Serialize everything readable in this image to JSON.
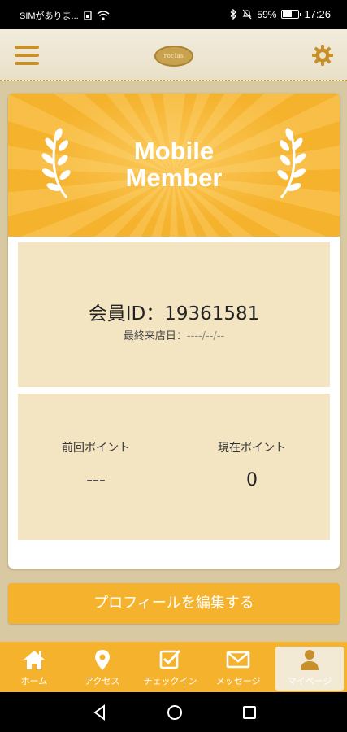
{
  "status_bar": {
    "carrier": "SIMがありま...",
    "battery": "59%",
    "time": "17:26"
  },
  "header": {
    "logo_text": "roclas"
  },
  "banner": {
    "title_line1": "Mobile",
    "title_line2": "Member"
  },
  "member": {
    "id_text": "会員ID：19361581",
    "last_visit_label": "最終来店日：",
    "last_visit_value": "----/--/--"
  },
  "points": {
    "previous_label": "前回ポイント",
    "previous_value": "---",
    "current_label": "現在ポイント",
    "current_value": "0"
  },
  "edit_button": "プロフィールを編集する",
  "bottom_nav": [
    {
      "label": "ホーム",
      "icon": "home-icon"
    },
    {
      "label": "アクセス",
      "icon": "map-pin-icon"
    },
    {
      "label": "チェックイン",
      "icon": "checkin-icon"
    },
    {
      "label": "メッセージ",
      "icon": "mail-icon"
    },
    {
      "label": "マイページ",
      "icon": "user-icon",
      "active": true
    }
  ],
  "colors": {
    "accent": "#f5b22c",
    "panel": "#f3e4c2",
    "background": "#d9c9a3"
  }
}
